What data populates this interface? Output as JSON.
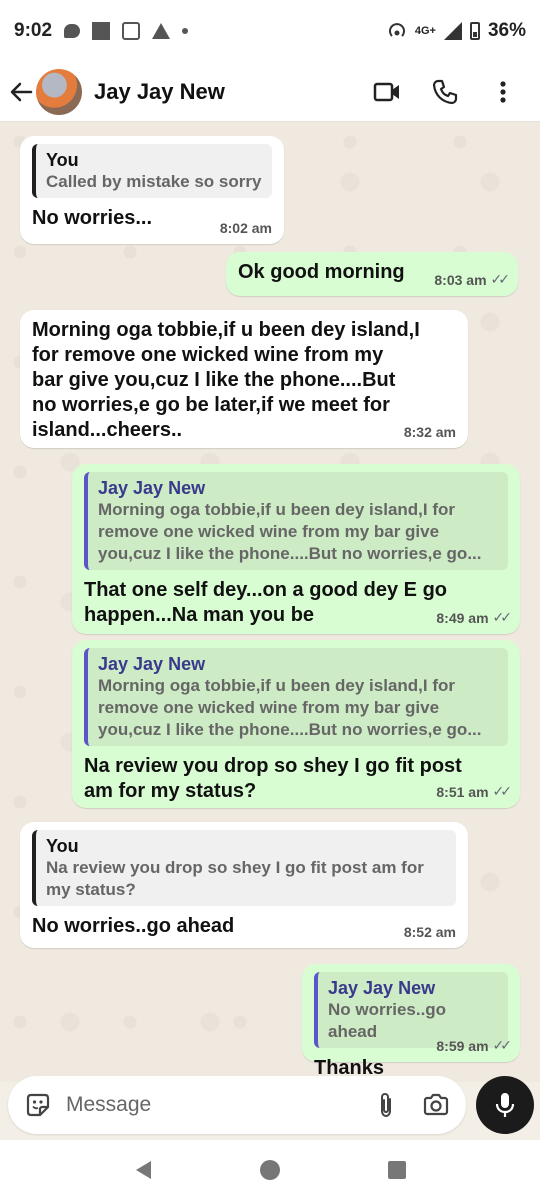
{
  "status_bar": {
    "time": "9:02",
    "network": "4G+",
    "battery": "36%"
  },
  "header": {
    "contact_name": "Jay Jay New"
  },
  "messages": [
    {
      "direction": "in",
      "quote_author": "You",
      "quote_text": "Called by mistake so sorry",
      "text": "No worries...",
      "time": "8:02 am"
    },
    {
      "direction": "out",
      "text": "Ok good morning",
      "time": "8:03 am"
    },
    {
      "direction": "in",
      "text_lines": [
        "Morning oga tobbie,if u been dey island,I",
        "for remove one wicked wine from my",
        "bar give you,cuz I like the phone....But",
        "no worries,e go be later,if we meet for",
        "island...cheers.."
      ],
      "time": "8:32 am"
    },
    {
      "direction": "out",
      "quote_author": "Jay Jay New",
      "quote_lines": [
        "Morning oga tobbie,if u been dey island,I for",
        "remove one wicked wine from my bar give",
        "you,cuz I like the phone....But no worries,e go..."
      ],
      "text_lines": [
        "That one self dey...on a good dey E go",
        "happen...Na man you be"
      ],
      "time": "8:49 am"
    },
    {
      "direction": "out",
      "quote_author": "Jay Jay New",
      "quote_lines": [
        "Morning oga tobbie,if u been dey island,I for",
        "remove one wicked wine from my bar give",
        "you,cuz I like the phone....But no worries,e go..."
      ],
      "text_lines": [
        "Na review you drop so shey I go fit post",
        "am for my status?"
      ],
      "time": "8:51 am"
    },
    {
      "direction": "in",
      "quote_author": "You",
      "quote_lines": [
        "Na review you drop so shey I go fit post am for",
        "my status?"
      ],
      "text": "No worries..go ahead",
      "time": "8:52 am"
    },
    {
      "direction": "out",
      "quote_author": "Jay Jay New",
      "quote_text": "No worries..go ahead",
      "text": "Thanks",
      "time": "8:59 am"
    }
  ],
  "input": {
    "placeholder": "Message"
  },
  "colors": {
    "outgoing_bubble": "#d9fdd3",
    "incoming_bubble": "#ffffff",
    "chat_background": "#efe9df",
    "reply_bar_outgoing": "#5b55c9"
  }
}
